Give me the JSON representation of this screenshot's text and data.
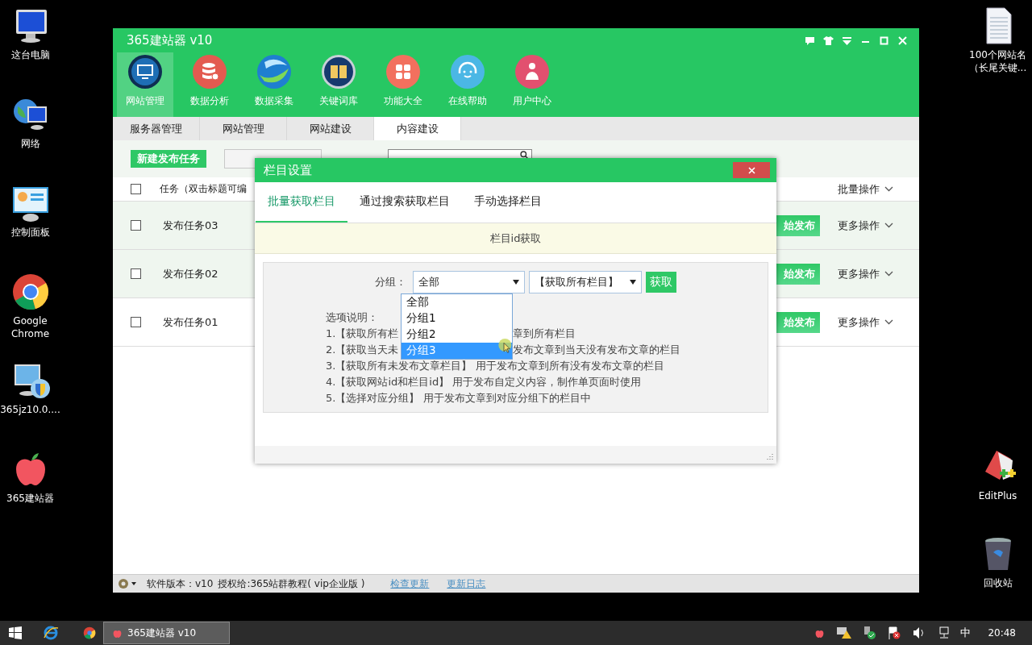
{
  "desktop": {
    "left_icons": [
      {
        "kind": "computer",
        "label": "这台电脑"
      },
      {
        "kind": "network",
        "label": "网络"
      },
      {
        "kind": "control_panel",
        "label": "控制面板"
      },
      {
        "kind": "browser",
        "label": "Google Chrome"
      },
      {
        "kind": "installer",
        "label": "365jz10.0...."
      },
      {
        "kind": "app",
        "label": "365建站器"
      }
    ],
    "right_icons": [
      {
        "kind": "document",
        "label": "100个网站名（长尾关键..."
      },
      {
        "kind": "editor",
        "label": "EditPlus"
      },
      {
        "kind": "recycle_bin",
        "label": "回收站"
      }
    ]
  },
  "window": {
    "title": "365建站器 v10",
    "nav": [
      {
        "kind": "site",
        "label": "网站管理",
        "selected": true
      },
      {
        "kind": "analysis",
        "label": "数据分析",
        "selected": false
      },
      {
        "kind": "collect",
        "label": "数据采集",
        "selected": false
      },
      {
        "kind": "keywords",
        "label": "关键词库",
        "selected": false
      },
      {
        "kind": "tools",
        "label": "功能大全",
        "selected": false
      },
      {
        "kind": "help",
        "label": "在线帮助",
        "selected": false
      },
      {
        "kind": "user",
        "label": "用户中心",
        "selected": false
      }
    ],
    "tabs": [
      {
        "label": "服务器管理",
        "selected": false
      },
      {
        "label": "网站管理",
        "selected": false
      },
      {
        "label": "网站建设",
        "selected": false
      },
      {
        "label": "内容建设",
        "selected": true
      }
    ],
    "new_task_button": "新建发布任务",
    "table": {
      "header": {
        "checked": false,
        "task": "任务（双击标题可编",
        "batch": "批量操作"
      },
      "rows": [
        {
          "title": "发布任务03",
          "checked": false,
          "highlighted": true,
          "start": "始发布",
          "more": "更多操作"
        },
        {
          "title": "发布任务02",
          "checked": false,
          "highlighted": true,
          "start": "始发布",
          "more": "更多操作"
        },
        {
          "title": "发布任务01",
          "checked": false,
          "highlighted": false,
          "start": "始发布",
          "more": "更多操作"
        }
      ]
    },
    "status_bar": {
      "version": "软件版本：v10",
      "license": "授权给:365站群教程( vip企业版 )",
      "links": [
        "检查更新",
        "更新日志"
      ]
    }
  },
  "dialog": {
    "title": "栏目设置",
    "tabs": [
      {
        "label": "批量获取栏目",
        "selected": true
      },
      {
        "label": "通过搜索获取栏目",
        "selected": false
      },
      {
        "label": "手动选择栏目",
        "selected": false
      }
    ],
    "banner": "栏目id获取",
    "group_label": "分组：",
    "group_select": "全部",
    "group_options": [
      {
        "label": "全部",
        "selected": false
      },
      {
        "label": "分组1",
        "selected": false
      },
      {
        "label": "分组2",
        "selected": false
      },
      {
        "label": "分组3",
        "selected": true
      }
    ],
    "scope_select": "【获取所有栏目】",
    "fetch_button": "获取",
    "notes_title": "选项说明：",
    "notes": [
      {
        "text": "1.【获取所有栏",
        "text_after": "章到所有栏目"
      },
      {
        "text": "2.【获取当天未",
        "text_after": "发布文章到当天没有发布文章的栏目"
      },
      {
        "text": "3.【获取所有未发布文章栏目】 用于发布文章到所有没有发布文章的栏目"
      },
      {
        "text": "4.【获取网站id和栏目id】 用于发布自定义内容，制作单页面时使用"
      },
      {
        "text": "5.【选择对应分组】 用于发布文章到对应分组下的栏目中"
      }
    ]
  },
  "taskbar": {
    "app": "365建站器 v10",
    "ime": "中",
    "clock": "20:48"
  }
}
